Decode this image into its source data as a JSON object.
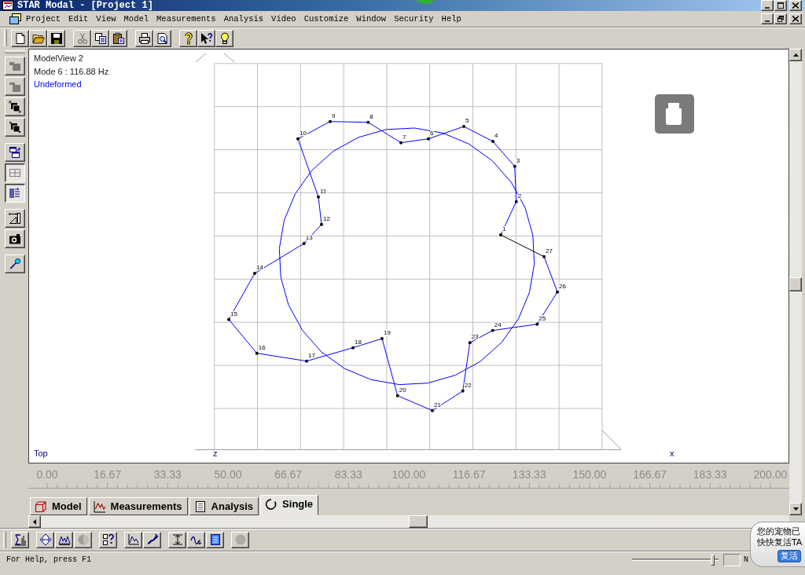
{
  "window": {
    "title": "STAR Modal - [Project 1]"
  },
  "menu_bar": {
    "items": [
      "Project",
      "Edit",
      "View",
      "Model",
      "Measurements",
      "Analysis",
      "Video",
      "Customize",
      "Window",
      "Security",
      "Help"
    ]
  },
  "toolbar": {
    "groups": [
      [
        {
          "disabled": false
        },
        {
          "disabled": false
        },
        {
          "disabled": false
        }
      ],
      [
        {
          "disabled": true
        },
        {
          "disabled": false
        },
        {
          "disabled": false
        }
      ],
      [
        {
          "disabled": false
        },
        {
          "disabled": false
        }
      ],
      [
        {
          "disabled": false
        },
        {
          "disabled": false
        },
        {
          "disabled": false
        }
      ]
    ]
  },
  "side_toolbar": {
    "groups": [
      [
        {
          "disabled": true,
          "pressed": false
        },
        {
          "disabled": true,
          "pressed": false
        },
        {
          "disabled": false,
          "pressed": false
        },
        {
          "disabled": false,
          "pressed": false
        }
      ],
      [
        {
          "disabled": false,
          "pressed": false
        },
        {
          "disabled": false,
          "pressed": true
        },
        {
          "disabled": false,
          "pressed": true
        }
      ],
      [
        {
          "disabled": false,
          "pressed": false
        },
        {
          "disabled": false,
          "pressed": false
        }
      ],
      [
        {
          "disabled": false,
          "pressed": false
        }
      ]
    ]
  },
  "model_view": {
    "title": "ModelView 2",
    "mode": "Mode 6 : 116.88 Hz",
    "shape_state": "Undeformed",
    "view": "Top",
    "axis_labels": [
      "z",
      "x"
    ],
    "nodes": [
      "1",
      "2",
      "3",
      "4",
      "5",
      "6",
      "7",
      "8",
      "9",
      "10",
      "11",
      "12",
      "13",
      "14",
      "15",
      "16",
      "17",
      "18",
      "19",
      "20",
      "21",
      "22",
      "23",
      "24",
      "25",
      "26",
      "27"
    ]
  },
  "frequency_ruler": {
    "labels": [
      "0.00",
      "16.67",
      "33.33",
      "50.00",
      "66.67",
      "83.33",
      "100.00",
      "116.67",
      "133.33",
      "150.00",
      "166.67",
      "183.33",
      "200.00"
    ]
  },
  "tabs": [
    {
      "label": "Model",
      "selected": false
    },
    {
      "label": "Measurements",
      "selected": false
    },
    {
      "label": "Analysis",
      "selected": false
    },
    {
      "label": "Single",
      "selected": true
    }
  ],
  "bottom_toolbar": {
    "groups": [
      [
        {
          "disabled": false
        }
      ],
      [
        {
          "disabled": false
        },
        {
          "disabled": false
        },
        {
          "disabled": true
        }
      ],
      [
        {
          "disabled": false
        }
      ],
      [
        {
          "disabled": false
        },
        {
          "disabled": false
        }
      ],
      [
        {
          "disabled": false
        },
        {
          "disabled": false
        },
        {
          "disabled": false
        }
      ],
      [
        {
          "disabled": true
        }
      ]
    ]
  },
  "status_bar": {
    "text": "For Help, press F1",
    "slider": {
      "level": 0.95
    },
    "indicator": "N"
  },
  "notification": {
    "lines": [
      "您的宠物已",
      "快快复活TA"
    ],
    "button": "复活"
  }
}
